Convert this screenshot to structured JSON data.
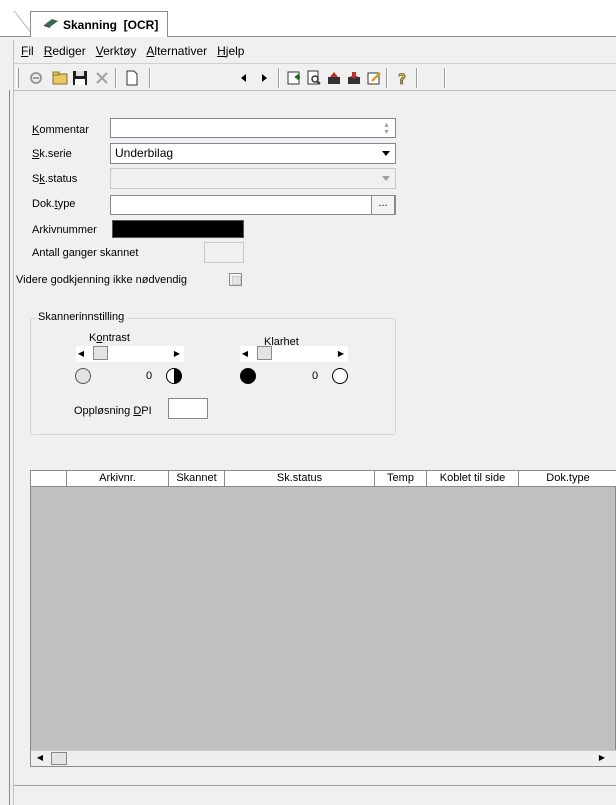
{
  "tab": {
    "title": "Skanning  [OCR]"
  },
  "menu": [
    {
      "label": "Fil",
      "key": "F",
      "rest": "il"
    },
    {
      "label": "Rediger",
      "key": "R",
      "rest": "ediger"
    },
    {
      "label": "Verktøy",
      "key": "V",
      "rest": "erktøy"
    },
    {
      "label": "Alternativer",
      "key": "A",
      "rest": "lternativer"
    },
    {
      "label": "Hjelp",
      "key": "H",
      "rest": "jelp"
    }
  ],
  "form": {
    "kommentar": {
      "label_key": "K",
      "label_rest": "ommentar",
      "value": ""
    },
    "skserie": {
      "label_key": "S",
      "label_rest": "k.serie",
      "value": "Underbilag"
    },
    "skstatus": {
      "label_pre": "S",
      "label_key": "k",
      "label_rest": ".status",
      "value": ""
    },
    "doktype": {
      "label_pre": "Dok.",
      "label_key": "t",
      "label_rest": "ype",
      "value": "",
      "browse": "..."
    },
    "arkivnummer": {
      "label": "Arkivnummer"
    },
    "antall": {
      "label": "Antall ganger skannet",
      "value": ""
    },
    "videre": {
      "label": "Videre godkjenning ikke nødvendig",
      "checked": false
    }
  },
  "scanner": {
    "group_title": "Skannerinnstilling",
    "kontrast": {
      "label_pre": "K",
      "label_key": "o",
      "label_rest": "ntrast",
      "value": "0"
    },
    "klarhet": {
      "label": "Klarhet",
      "value": "0"
    },
    "dpi": {
      "label_pre": "Oppløsning ",
      "label_key": "D",
      "label_rest": "PI",
      "value": ""
    }
  },
  "grid": {
    "columns": [
      "",
      "Arkivnr.",
      "Skannet",
      "Sk.status",
      "Temp",
      "Koblet til side",
      "Dok.type"
    ]
  },
  "colors": {
    "grid_bg": "#c0c0c0",
    "window_bg": "#f0f0f0"
  }
}
